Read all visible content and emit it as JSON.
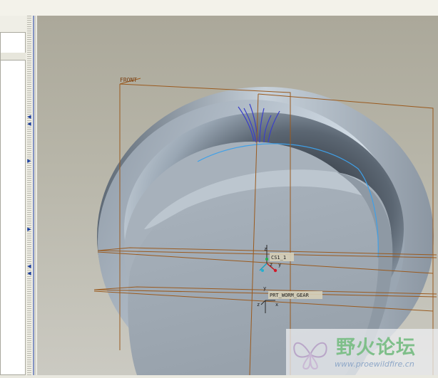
{
  "viewport": {
    "datums": {
      "front_plane_label": "FRONT",
      "csys_label": "CS1_1",
      "part_csys_label": "PRT_WORM_GEAR"
    },
    "axes": {
      "x": "x",
      "y": "y",
      "z": "z"
    }
  },
  "watermark": {
    "name_cn": "野火论坛",
    "url": "www.proewildfire.cn"
  },
  "colors": {
    "viewport_bg_top": "#aba89a",
    "datum_plane": "#9a5a1e",
    "model_surface": "#a9b3bd",
    "sketch_curve": "#3a3fc8",
    "edge_highlight": "#3fa0e8"
  },
  "icons": {
    "sash_arrows": [
      "chevron-left-icon",
      "chevron-right-icon"
    ],
    "logo": "butterfly-logo-icon"
  }
}
